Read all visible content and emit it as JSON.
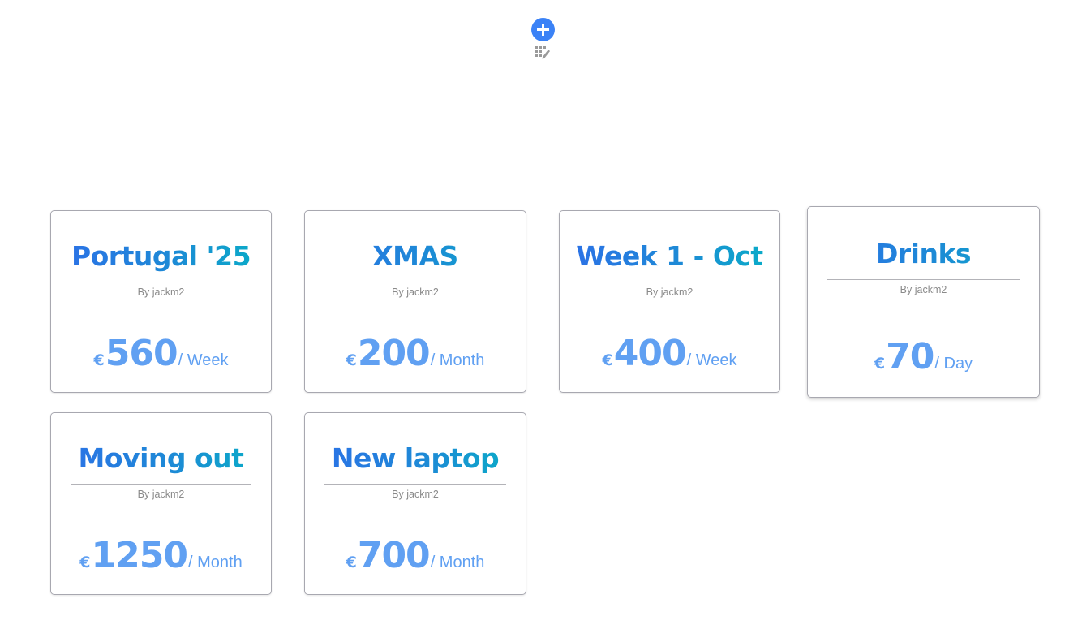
{
  "toolbar": {
    "add_icon": "plus-icon",
    "edit_icon": "grid-edit-icon",
    "accent_color": "#3b82f6"
  },
  "cards": [
    {
      "title": "Portugal '25",
      "author": "By jackm2",
      "currency": "€",
      "amount": "560",
      "period": "/ Week"
    },
    {
      "title": "XMAS",
      "author": "By jackm2",
      "currency": "€",
      "amount": "200",
      "period": "/ Month"
    },
    {
      "title": "Week 1 - Oct",
      "author": "By jackm2",
      "currency": "€",
      "amount": "400",
      "period": "/ Week"
    },
    {
      "title": "Drinks",
      "author": "By jackm2",
      "currency": "€",
      "amount": "70",
      "period": "/ Day"
    },
    {
      "title": "Moving out",
      "author": "By jackm2",
      "currency": "€",
      "amount": "1250",
      "period": "/ Month"
    },
    {
      "title": "New laptop",
      "author": "By jackm2",
      "currency": "€",
      "amount": "700",
      "period": "/ Month"
    }
  ],
  "colors": {
    "title_gradient_start": "#2d6fe8",
    "title_gradient_end": "#07b0c6",
    "price": "#60a0f2",
    "card_border": "#a8a8b0"
  }
}
